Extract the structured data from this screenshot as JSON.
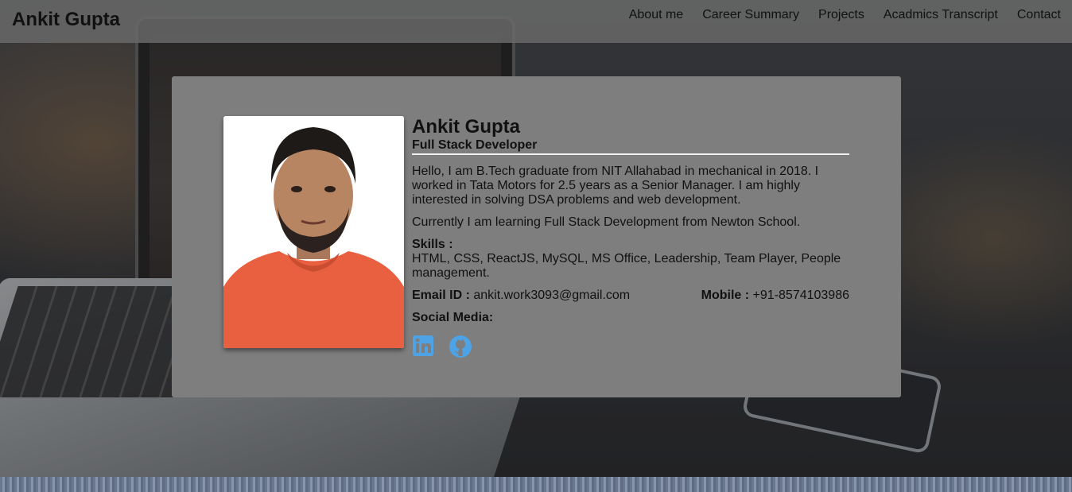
{
  "nav": {
    "brand": "Ankit Gupta",
    "links": [
      "About me",
      "Career Summary",
      "Projects",
      "Acadmics Transcript",
      "Contact"
    ]
  },
  "profile": {
    "name": "Ankit Gupta",
    "role": "Full Stack Developer",
    "bio": "Hello, I am B.Tech graduate from NIT Allahabad in mechanical in 2018. I worked in Tata Motors for 2.5 years as a Senior Manager. I am highly interested in solving DSA problems and web development.",
    "learning": "Currently I am learning Full Stack Development from Newton School.",
    "skills_label": "Skills :",
    "skills": "HTML, CSS, ReactJS, MySQL, MS Office, Leadership, Team Player, People management.",
    "email_label": "Email ID :",
    "email": "ankit.work3093@gmail.com",
    "mobile_label": "Mobile :",
    "mobile": "+91-8574103986",
    "social_label": "Social Media:",
    "social_icons": [
      "linkedin-icon",
      "github-icon"
    ]
  },
  "colors": {
    "nav_bg": "#696969",
    "card_bg": "#7e7e7e",
    "icon_blue": "#4da3e6",
    "shirt": "#e8603f"
  }
}
